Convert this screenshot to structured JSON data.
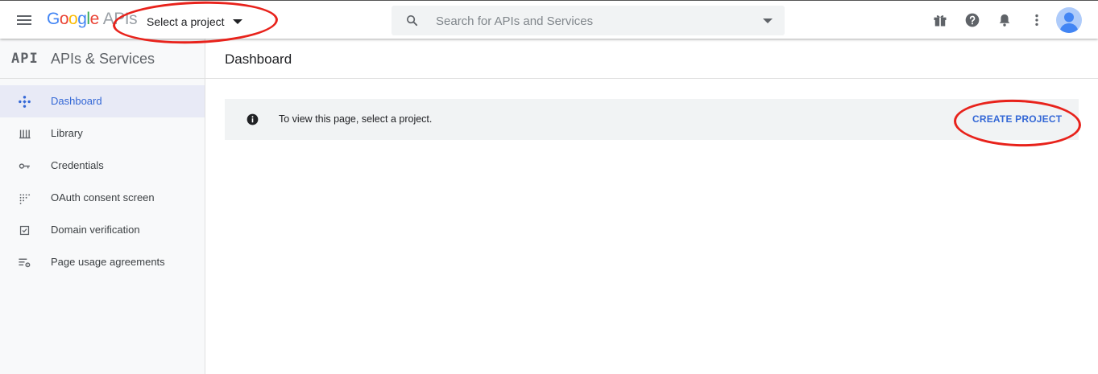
{
  "header": {
    "logo": {
      "g1": "G",
      "o1": "o",
      "o2": "o",
      "g2": "g",
      "l": "l",
      "e": "e",
      "suffix": "APIs"
    },
    "project_picker_label": "Select a project",
    "search_placeholder": "Search for APIs and Services",
    "icons": [
      "gift-icon",
      "help-icon",
      "notifications-icon",
      "more-vert-icon",
      "account-avatar"
    ]
  },
  "sidebar": {
    "brand_mark": "API",
    "title": "APIs & Services",
    "items": [
      {
        "label": "Dashboard",
        "icon": "dashboard-diamond-icon",
        "active": true
      },
      {
        "label": "Library",
        "icon": "library-icon",
        "active": false
      },
      {
        "label": "Credentials",
        "icon": "key-icon",
        "active": false
      },
      {
        "label": "OAuth consent screen",
        "icon": "consent-grid-icon",
        "active": false
      },
      {
        "label": "Domain verification",
        "icon": "checkbox-icon",
        "active": false
      },
      {
        "label": "Page usage agreements",
        "icon": "settings-list-icon",
        "active": false
      }
    ]
  },
  "main": {
    "page_title": "Dashboard",
    "notice": {
      "message": "To view this page, select a project.",
      "action_label": "CREATE PROJECT"
    }
  },
  "colors": {
    "accent": "#3367d6",
    "annotation": "#e8221b",
    "active_nav_bg": "#e8eaf6"
  }
}
